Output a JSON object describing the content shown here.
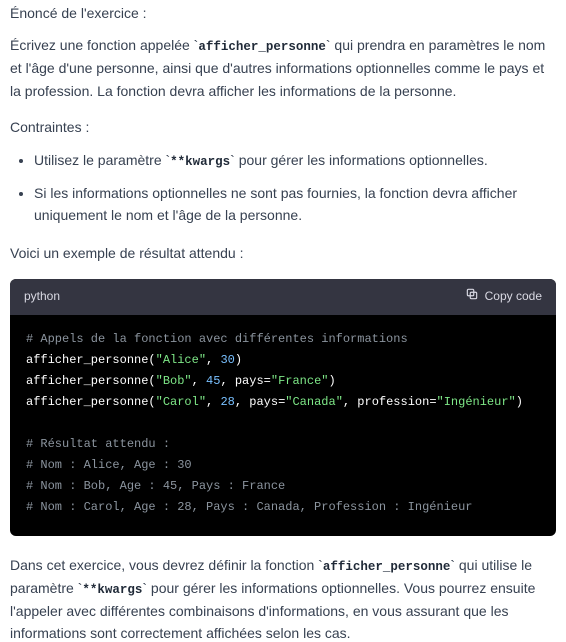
{
  "intro": {
    "heading": "Énoncé de l'exercice :",
    "p1_a": "Écrivez une fonction appelée `",
    "p1_code": "afficher_personne",
    "p1_b": "` qui prendra en paramètres le nom et l'âge d'une personne, ainsi que d'autres informations optionnelles comme le pays et la profession. La fonction devra afficher les informations de la personne."
  },
  "constraints": {
    "heading": "Contraintes :",
    "li1_a": "Utilisez le paramètre `",
    "li1_code": "**kwargs",
    "li1_b": "` pour gérer les informations optionnelles.",
    "li2": "Si les informations optionnelles ne sont pas fournies, la fonction devra afficher uniquement le nom et l'âge de la personne."
  },
  "example_intro": "Voici un exemple de résultat attendu :",
  "code": {
    "lang": "python",
    "copy_label": "Copy code",
    "c1": "# Appels de la fonction avec différentes informations",
    "call1": {
      "fn": "afficher_personne",
      "name": "\"Alice\"",
      "age": "30"
    },
    "call2": {
      "fn": "afficher_personne",
      "name": "\"Bob\"",
      "age": "45",
      "k1": "pays",
      "v1": "\"France\""
    },
    "call3": {
      "fn": "afficher_personne",
      "name": "\"Carol\"",
      "age": "28",
      "k1": "pays",
      "v1": "\"Canada\"",
      "k2": "profession",
      "v2": "\"Ingénieur\""
    },
    "c2": "# Résultat attendu :",
    "r1": "# Nom : Alice, Age : 30",
    "r2": "# Nom : Bob, Age : 45, Pays : France",
    "r3": "# Nom : Carol, Age : 28, Pays : Canada, Profession : Ingénieur"
  },
  "outro": {
    "a": "Dans cet exercice, vous devrez définir la fonction `",
    "code1": "afficher_personne",
    "b": "` qui utilise le paramètre `",
    "code2": "**kwargs",
    "c": "` pour gérer les informations optionnelles. Vous pourrez ensuite l'appeler avec différentes combinaisons d'informations, en vous assurant que les informations sont correctement affichées selon les cas."
  }
}
